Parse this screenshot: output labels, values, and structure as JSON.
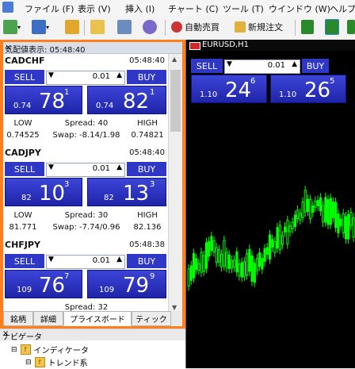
{
  "menu": [
    "ファイル (F)",
    "表示 (V)",
    "挿入 (I)",
    "チャート (C)",
    "ツール (T)",
    "ウインドウ (W)",
    "ヘルプ"
  ],
  "toolbar": {
    "auto_trade": "自動売買",
    "new_order": "新規注文"
  },
  "market_watch": {
    "title": "気配値表示: 05:48:40",
    "symbols": [
      {
        "name": "CADCHF",
        "time": "05:48:40",
        "sell": "SELL",
        "buy": "BUY",
        "lot": "0.01",
        "bid_prefix": "0.74",
        "bid_big": "78",
        "bid_sup": "1",
        "ask_prefix": "0.74",
        "ask_big": "82",
        "ask_sup": "1",
        "low_label": "LOW",
        "low": "0.74525",
        "spread": "Spread: 40",
        "swap": "Swap: -8.14/1.98",
        "high_label": "HIGH",
        "high": "0.74821"
      },
      {
        "name": "CADJPY",
        "time": "05:48:40",
        "sell": "SELL",
        "buy": "BUY",
        "lot": "0.01",
        "bid_prefix": "82",
        "bid_big": "10",
        "bid_sup": "3",
        "ask_prefix": "82",
        "ask_big": "13",
        "ask_sup": "3",
        "low_label": "LOW",
        "low": "81.771",
        "spread": "Spread: 30",
        "swap": "Swap: -7.74/0.96",
        "high_label": "HIGH",
        "high": "82.136"
      },
      {
        "name": "CHFJPY",
        "time": "05:48:38",
        "sell": "SELL",
        "buy": "BUY",
        "lot": "0.01",
        "bid_prefix": "109",
        "bid_big": "76",
        "bid_sup": "7",
        "ask_prefix": "109",
        "ask_big": "79",
        "ask_sup": "9",
        "low_label": "LOW",
        "low": "",
        "spread": "Spread: 32",
        "swap": "",
        "high_label": "HIGH",
        "high": ""
      }
    ],
    "tabs": [
      "銘柄",
      "詳細",
      "プライスボード",
      "ティック"
    ]
  },
  "navigator": {
    "title": "ナビゲータ",
    "items": [
      "インディケータ",
      "トレンド系"
    ]
  },
  "chart": {
    "title": "EURUSD,H1",
    "sell": "SELL",
    "buy": "BUY",
    "lot": "0.01",
    "bid_prefix": "1.10",
    "bid_big": "24",
    "bid_sup": "6",
    "ask_prefix": "1.10",
    "ask_big": "26",
    "ask_sup": "5",
    "candle_color": "#00ff00"
  }
}
